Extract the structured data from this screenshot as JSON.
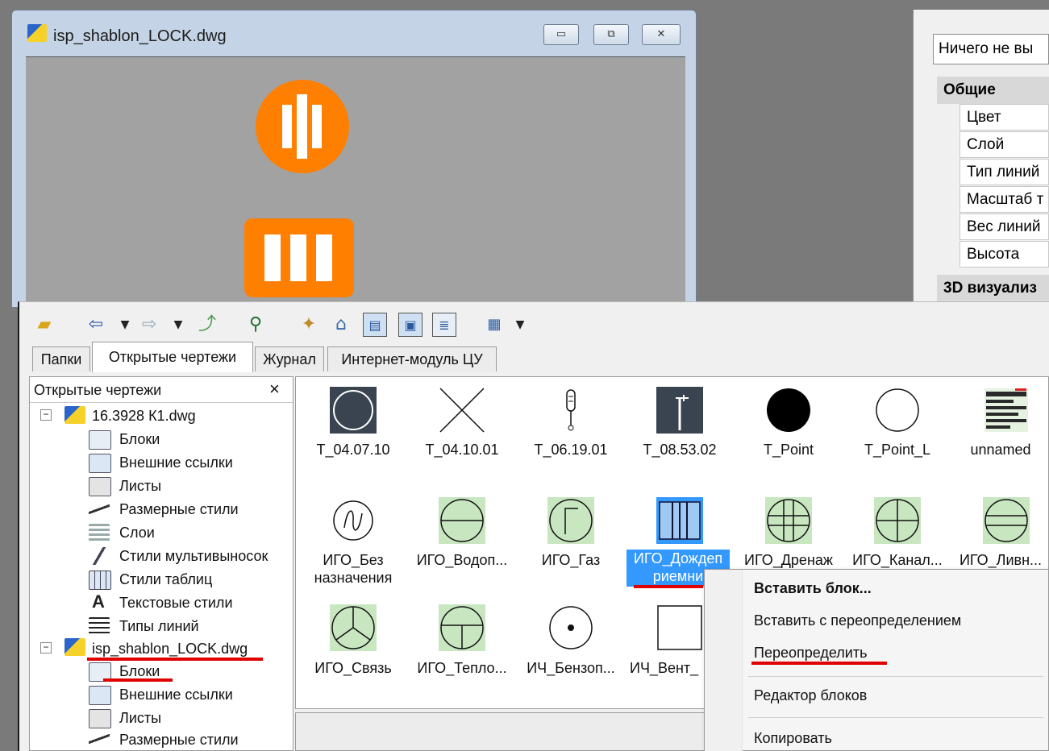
{
  "drawing_window": {
    "title": "isp_shablon_LOCK.dwg",
    "min_label": "▭",
    "restore_label": "⧉",
    "close_label": "✕"
  },
  "properties": {
    "selection": "Ничего не вы",
    "category_general": "Общие",
    "rows": [
      "Цвет",
      "Слой",
      "Тип линий",
      "Масштаб т",
      "Вес линий",
      "Высота"
    ],
    "category_3d": "3D визуализ"
  },
  "design_center": {
    "tabs": [
      "Папки",
      "Открытые чертежи",
      "Журнал",
      "Интернет-модуль ЦУ"
    ],
    "tree_header": "Открытые чертежи",
    "tree_close": "×",
    "tree": {
      "drawing1": "16.3928 К1.dwg",
      "drawing1_children": [
        "Блоки",
        "Внешние ссылки",
        "Листы",
        "Размерные стили",
        "Слои",
        "Стили мультивыносок",
        "Стили таблиц",
        "Текстовые стили",
        "Типы линий"
      ],
      "drawing2": "isp_shablon_LOCK.dwg",
      "drawing2_children": [
        "Блоки",
        "Внешние ссылки",
        "Листы",
        "Размерные стили"
      ]
    },
    "blocks_row1": [
      "T_04.07.10",
      "T_04.10.01",
      "T_06.19.01",
      "T_08.53.02",
      "T_Point",
      "T_Point_L",
      "unnamed"
    ],
    "blocks_row2": [
      "ИГО_Без назначения",
      "ИГО_Водоп...",
      "ИГО_Газ",
      "ИГО_Дождеп риемни",
      "ИГО_Дренаж",
      "ИГО_Канал...",
      "ИГО_Ливн..."
    ],
    "blocks_row3": [
      "ИГО_Связь",
      "ИГО_Тепло...",
      "ИЧ_Бензоп...",
      "ИЧ_Вент_"
    ]
  },
  "context_menu": {
    "items": [
      "Вставить блок...",
      "Вставить с переопределением",
      "Переопределить",
      "Редактор блоков",
      "Копировать"
    ]
  },
  "colors": {
    "accent": "#ff7f00",
    "selection": "#3399ff",
    "annotation": "#e00000",
    "thumb_green": "#c8e6c0"
  }
}
